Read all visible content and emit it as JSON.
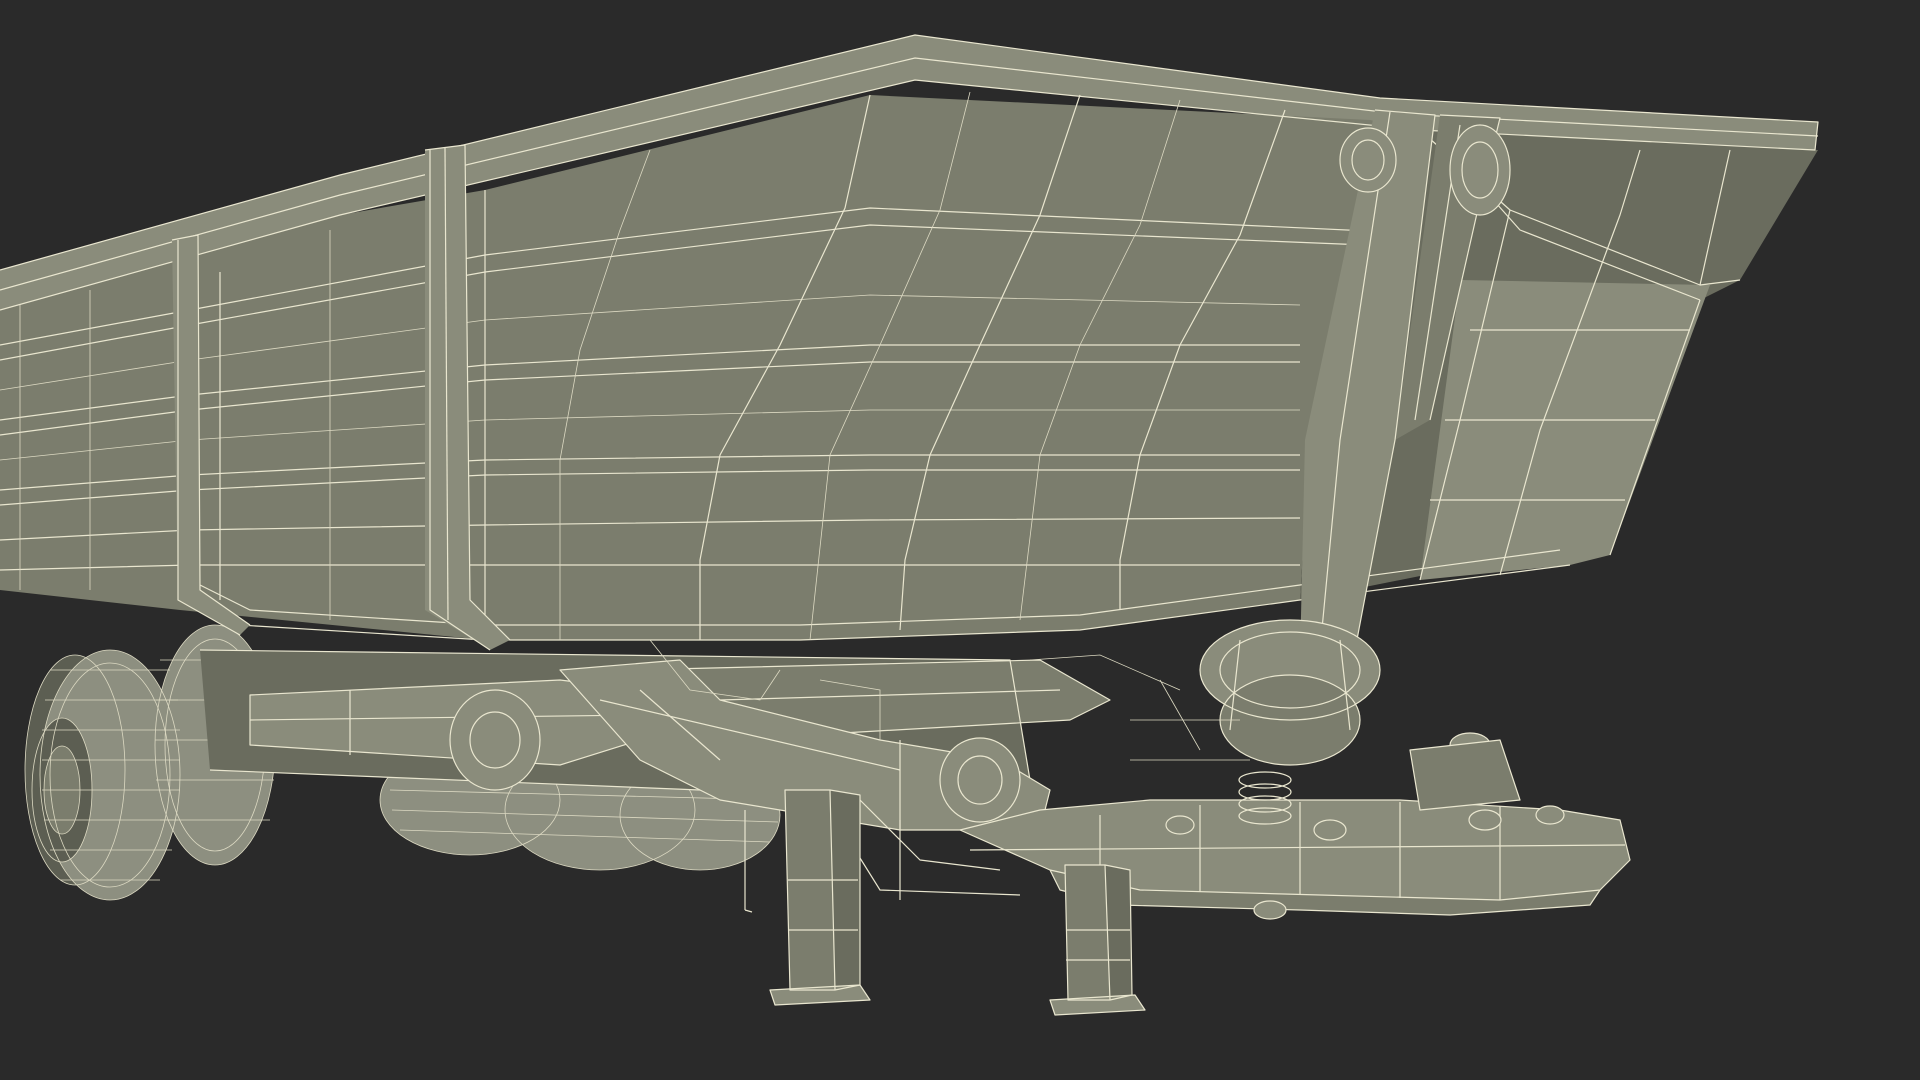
{
  "scene": {
    "subject": "dump-semi-trailer-wireframe-render",
    "colors": {
      "background": "#2a2a2a",
      "body": "#7b7d6d",
      "body_dark": "#6a6c5e",
      "body_light": "#8a8c7b",
      "wireframe": "#e9e6cf"
    }
  }
}
